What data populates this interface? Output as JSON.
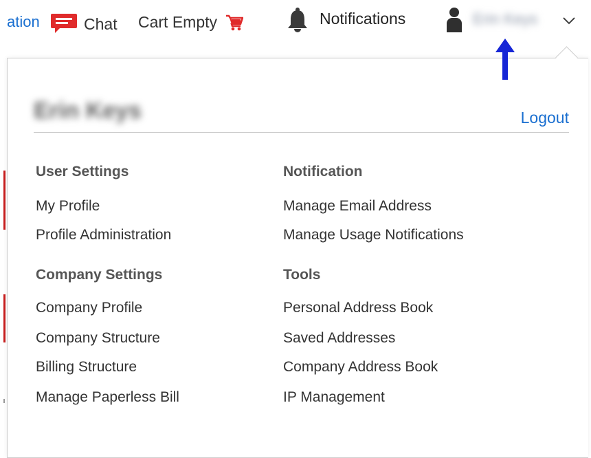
{
  "topbar": {
    "nav_partial_label": "ation",
    "chat_label": "Chat",
    "cart_label": "Cart Empty",
    "notifications_label": "Notifications",
    "username": "Erin Keys"
  },
  "panel": {
    "username": "Erin Keys",
    "logout_label": "Logout",
    "user_settings": {
      "heading": "User Settings",
      "items": [
        "My Profile",
        "Profile Administration"
      ]
    },
    "company_settings": {
      "heading": "Company Settings",
      "items": [
        "Company Profile",
        "Company Structure",
        "Billing Structure",
        "Manage Paperless Bill"
      ]
    },
    "notification": {
      "heading": "Notification",
      "items": [
        "Manage Email Address",
        "Manage Usage Notifications"
      ]
    },
    "tools": {
      "heading": "Tools",
      "items": [
        "Personal Address Book",
        "Saved Addresses",
        "Company Address Book",
        "IP Management"
      ]
    }
  },
  "colors": {
    "link_blue": "#1a6fd0",
    "brand_red": "#e02b2b",
    "arrow_blue": "#1626d6",
    "text_dark": "#333333"
  },
  "icons": [
    "chat-icon",
    "cart-icon",
    "bell-icon",
    "user-icon",
    "chevron-down-icon",
    "annotation-arrow-icon"
  ]
}
